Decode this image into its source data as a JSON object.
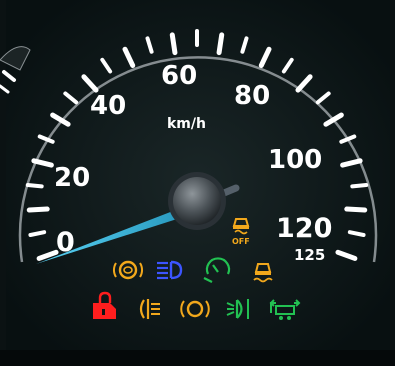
{
  "speedometer": {
    "unit": "km/h",
    "labels": [
      "0",
      "20",
      "40",
      "60",
      "80",
      "100",
      "120"
    ],
    "secondary_label": "125",
    "needle_value_kmh": 0,
    "needle_color": "#5ad2f4"
  },
  "warning_lights": [
    {
      "name": "traction-control-off-icon",
      "text": "OFF",
      "color": "#f2a81c"
    },
    {
      "name": "epb-brake-icon",
      "color": "#f2a81c"
    },
    {
      "name": "headlight-high-beam-icon",
      "color": "#3c55ff"
    },
    {
      "name": "cruise-control-icon",
      "color": "#22c152"
    },
    {
      "name": "traction-control-icon",
      "color": "#f2a81c"
    },
    {
      "name": "door-lock-warning-icon",
      "color": "#ff1e1e"
    },
    {
      "name": "rear-fog-light-icon",
      "color": "#f2a81c"
    },
    {
      "name": "brake-pad-wear-icon",
      "color": "#f2a81c"
    },
    {
      "name": "front-fog-light-icon",
      "color": "#22c152"
    },
    {
      "name": "trailer-indicator-icon",
      "color": "#22c152"
    }
  ],
  "colors": {
    "background": "#0e1617",
    "tick": "#ffffff",
    "bezel": "#c8cdd0"
  }
}
